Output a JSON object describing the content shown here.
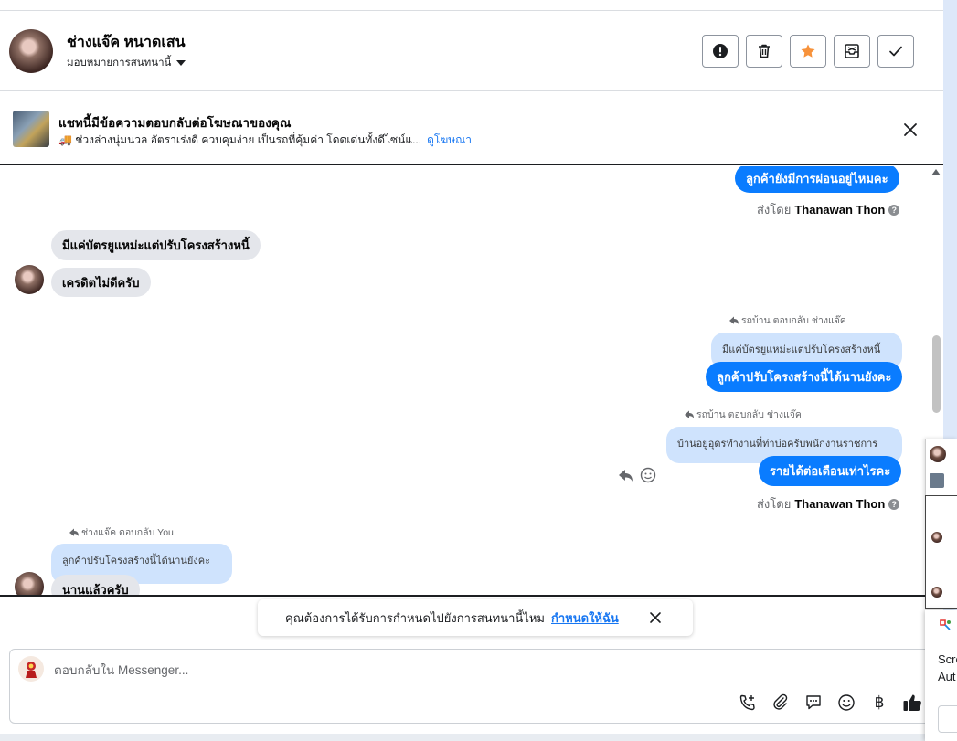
{
  "header": {
    "contact_name": "ช่างแจ๊ค หนาดเสน",
    "assign_label": "มอบหมายการสนทนานี้",
    "actions": [
      "alert-icon",
      "trash-icon",
      "star-icon",
      "archive-icon",
      "check-icon"
    ],
    "star_color": "#f7923b"
  },
  "ad_banner": {
    "title": "แชทนี้มีข้อความตอบกลับต่อโฆษณาของคุณ",
    "description": "🚚 ช่วงล่างนุ่มนวล อัตราเร่งดี ควบคุมง่าย เป็นรถที่คุ้มค่า โดดเด่นทั้งดีไซน์แ...",
    "link_label": "ดูโฆษณา"
  },
  "messages": {
    "m1_text": "ลูกค้ายังมีการผ่อนอยู่ไหมคะ",
    "m1_sent_prefix": "ส่งโดย",
    "m1_sent_by": "Thanawan Thon",
    "m2_text": "มีแค่บัตรยูแหม่ะแต่ปรับโครงสร้างหนี้",
    "m3_text": "เครดิตไม่ดีครับ",
    "m4_reply_meta": "รถบ้าน ตอบกลับ ช่างแจ๊ค",
    "m4_quote": "มีแค่บัตรยูแหม่ะแต่ปรับโครงสร้างหนี้",
    "m4_text": "ลูกค้าปรับโครงสร้างนี้ได้นานยังคะ",
    "m5_reply_meta": "รถบ้าน ตอบกลับ ช่างแจ๊ค",
    "m5_quote": "บ้านอยู่อุดรทำงานที่ท่าบ่อครับพนักงานราชการ",
    "m5_text": "รายได้ต่อเดือนเท่าไรคะ",
    "m5_sent_prefix": "ส่งโดย",
    "m5_sent_by": "Thanawan Thon",
    "m6_reply_meta": "ช่างแจ๊ค ตอบกลับ You",
    "m6_quote": "ลูกค้าปรับโครงสร้างนี้ได้นานยังคะ",
    "m6_text": "นานแล้วครับ",
    "help_glyph": "?"
  },
  "suggestion": {
    "text": "คุณต้องการได้รับการกำหนดไปยังการสนทนานี้ไหม",
    "link_label": "กำหนดให้ฉัน"
  },
  "composer": {
    "placeholder": "ตอบกลับใน Messenger...",
    "tools": [
      "phone-add-icon",
      "paperclip-icon",
      "chat-bubble-icon",
      "emoji-icon",
      "baht-icon",
      "like-icon"
    ],
    "baht_glyph": "฿"
  },
  "overlay": {
    "popup_line1": "Scre",
    "popup_line2": "Aut"
  },
  "colors": {
    "brand_blue": "#0a7cff",
    "quote_bg": "#cfe3fd",
    "incoming_bg": "#e4e6eb"
  }
}
